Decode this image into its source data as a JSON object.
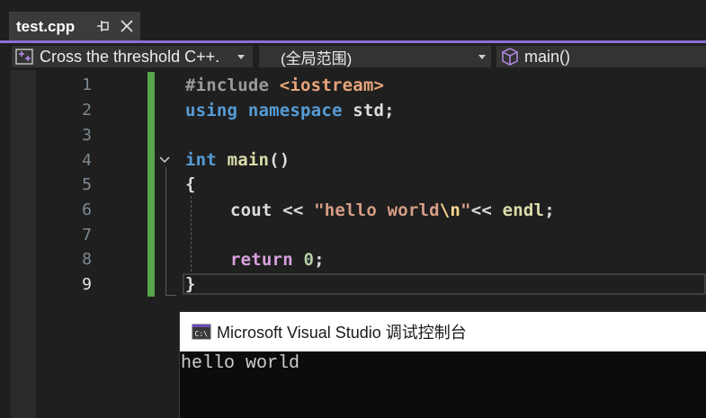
{
  "tab": {
    "title": "test.cpp"
  },
  "nav": {
    "project": "Cross the threshold C++.",
    "scope": "(全局范围)",
    "function": "main()"
  },
  "editor": {
    "line_numbers": [
      "1",
      "2",
      "3",
      "4",
      "5",
      "6",
      "7",
      "8",
      "9"
    ],
    "active_line": "9",
    "code": {
      "l1_directive": "#include",
      "l1_header": "<iostream>",
      "l2_using": "using",
      "l2_namespace": "namespace",
      "l2_rest": "std;",
      "l4_type": "int",
      "l4_func": "main",
      "l4_parens": "()",
      "l5_open": "{",
      "l6_cout": "cout",
      "l6_op1": "<<",
      "l6_str_a": "\"hello world",
      "l6_escape": "\\n",
      "l6_str_b": "\"",
      "l6_op2": "<<",
      "l6_endl": "endl",
      "l6_semi": ";",
      "l8_return": "return",
      "l8_zero": "0",
      "l8_semi": ";",
      "l9_close": "}"
    }
  },
  "console": {
    "title": "Microsoft Visual Studio 调试控制台",
    "output": "hello world"
  },
  "colors": {
    "accent": "#8a6fd6",
    "change_bar": "#57a64a",
    "keyword": "#569cd6",
    "control_keyword": "#d8a0df",
    "function": "#dcdcaa",
    "string": "#d69d85"
  }
}
